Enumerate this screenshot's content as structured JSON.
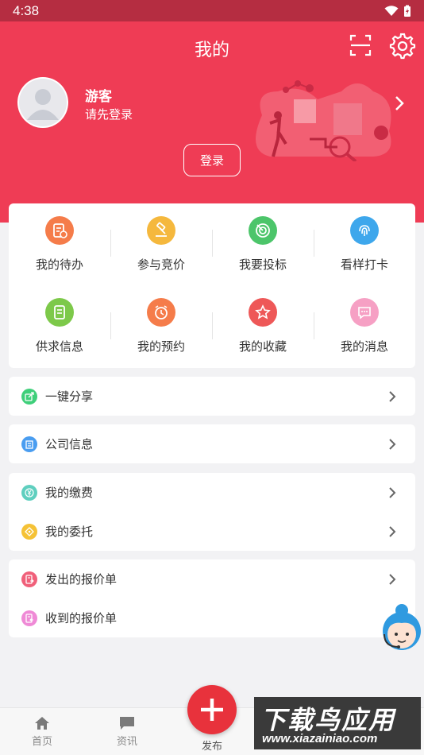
{
  "status_bar": {
    "time": "4:38"
  },
  "header": {
    "title": "我的",
    "user_name": "游客",
    "user_subtitle": "请先登录",
    "login_label": "登录",
    "background_color": "#ef3c55"
  },
  "grid": {
    "items": [
      {
        "label": "我的待办",
        "icon": "document-clock-icon",
        "color": "#f57c4a"
      },
      {
        "label": "参与竞价",
        "icon": "gavel-icon",
        "color": "#f5b83d"
      },
      {
        "label": "我要投标",
        "icon": "target-icon",
        "color": "#4cc56a"
      },
      {
        "label": "看样打卡",
        "icon": "fingerprint-icon",
        "color": "#3ea7ec"
      },
      {
        "label": "供求信息",
        "icon": "document-icon",
        "color": "#7dc94a"
      },
      {
        "label": "我的预约",
        "icon": "alarm-clock-icon",
        "color": "#f57c4a"
      },
      {
        "label": "我的收藏",
        "icon": "star-icon",
        "color": "#ee5858"
      },
      {
        "label": "我的消息",
        "icon": "chat-bubble-icon",
        "color": "#f6a0c4"
      }
    ]
  },
  "menus": {
    "share": {
      "label": "一键分享",
      "icon": "share-icon",
      "color": "#3fcf7a"
    },
    "company": {
      "label": "公司信息",
      "icon": "building-icon",
      "color": "#4a9df0"
    },
    "fees": {
      "label": "我的缴费",
      "icon": "yen-icon",
      "color": "#5fcfbf"
    },
    "entrust": {
      "label": "我的委托",
      "icon": "tag-icon",
      "color": "#f5c236"
    },
    "quotes_sent": {
      "label": "发出的报价单",
      "icon": "quote-sent-icon",
      "color": "#f0607a"
    },
    "quotes_received": {
      "label": "收到的报价单",
      "icon": "quote-received-icon",
      "color": "#ef8ad6"
    }
  },
  "bottom_nav": {
    "home": "首页",
    "news": "资讯",
    "publish": "发布"
  },
  "watermark": {
    "title": "下载鸟应用",
    "url": "www.xiazainiao.com"
  }
}
